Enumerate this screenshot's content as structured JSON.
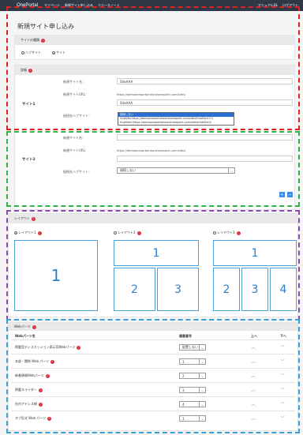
{
  "topbar": {
    "brand": "OnePortal",
    "nav": [
      "マイページ",
      "新規サイト申し込み",
      "リリースノート"
    ],
    "right": [
      "マニュアルDL",
      "ログアウト"
    ]
  },
  "page_title": "新規サイト申し込み",
  "site_type": {
    "header": "サイトの種類",
    "options": [
      "ハブサイト",
      "サイト"
    ]
  },
  "details": {
    "header": "詳細",
    "site1": {
      "label": "サイト1",
      "name_label": "新規サイト名：",
      "name_value": "SiteAAA",
      "url_label": "新規サイトURL：",
      "url_prefix": "https://demooneportalnew.sharepoint.com/sites/",
      "url_value": "SiteAAA",
      "hub_label": "接続先ハブサイト：",
      "hub_options": [
        "接続しない",
        "HubSite(https://demooneportalnew.sharepoint.com/sites/HubSite111)",
        "HubSite2(https://demooneportalnew.sharepoint.com/sites/HubSite2)"
      ]
    },
    "site2": {
      "label": "サイト2",
      "name_label": "新規サイト名：",
      "url_label": "新規サイトURL：",
      "url_prefix": "https://demooneportalnew.sharepoint.com/sites/",
      "hub_label": "接続先ハブサイト：",
      "hub_value": "接続しない"
    },
    "add_label": "+",
    "remove_label": "−"
  },
  "layout": {
    "header": "レイアウト",
    "options": [
      "レイアウト1",
      "レイアウト2",
      "レイアウト3"
    ],
    "numbers": [
      "1",
      "1",
      "2",
      "3",
      "1",
      "2",
      "3",
      "4"
    ]
  },
  "webparts": {
    "header": "Webパーツ",
    "columns": [
      "Webパーツ名",
      "順番番号",
      "上へ",
      "下へ"
    ],
    "rows": [
      {
        "name": "掲載型ディスカッション表示用Webパーツ",
        "order": "配置しない"
      },
      {
        "name": "本部・関係 Web パーツ",
        "order": "1"
      },
      {
        "name": "新着情報Webパーツ",
        "order": "2"
      },
      {
        "name": "掲載スライダー",
        "order": "3"
      },
      {
        "name": "社内アドレス帳",
        "order": "4"
      },
      {
        "name": "タブ形式 Web パーツ",
        "order": "1"
      }
    ],
    "up_glyph": "︿",
    "down_glyph": "﹀"
  },
  "colors": {
    "topbar": "#2f3846",
    "required": "#d9313b",
    "accent": "#3c8ee8",
    "dash_red": "#e02020",
    "dash_green": "#2cb34a",
    "dash_purple": "#8a4bb0",
    "dash_blue": "#3aa0d8"
  }
}
